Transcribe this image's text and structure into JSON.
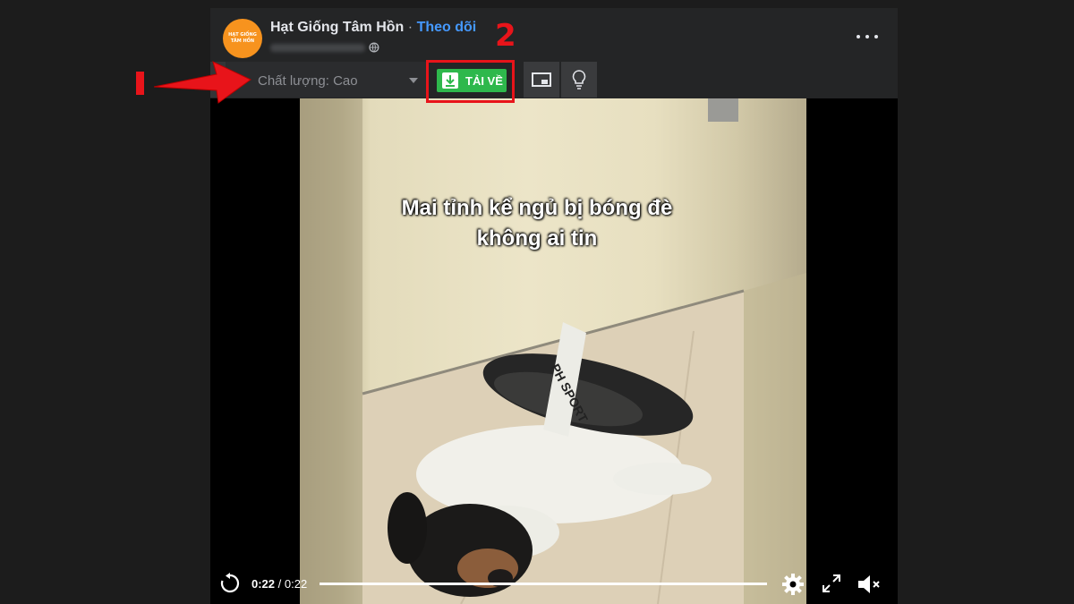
{
  "post": {
    "page_name": "Hạt Giống Tâm Hồn",
    "separator": "·",
    "follow_label": "Theo dõi",
    "avatar_text_top": "HẠT GIỐNG",
    "avatar_text_bottom": "TÂM HỒN"
  },
  "toolbar": {
    "quality_label": "Chất lượng: Cao",
    "download_label": "TẢI VỀ"
  },
  "video": {
    "caption_line1": "Mai tỉnh kể ngủ bị bóng đè",
    "caption_line2": "không ai tin",
    "time_current": "0:22",
    "time_separator": " / ",
    "time_total": "0:22",
    "progress_fraction": 1.0
  },
  "annotations": {
    "label_2": "2",
    "color": "#e8141a"
  },
  "colors": {
    "download_green": "#2eb84c",
    "link_blue": "#4599ff",
    "avatar_orange": "#f7931e"
  },
  "icons": [
    "globe-icon",
    "more-icon",
    "download-icon",
    "pip-icon",
    "lightbulb-icon",
    "replay-icon",
    "settings-icon",
    "fullscreen-icon",
    "mute-icon"
  ]
}
